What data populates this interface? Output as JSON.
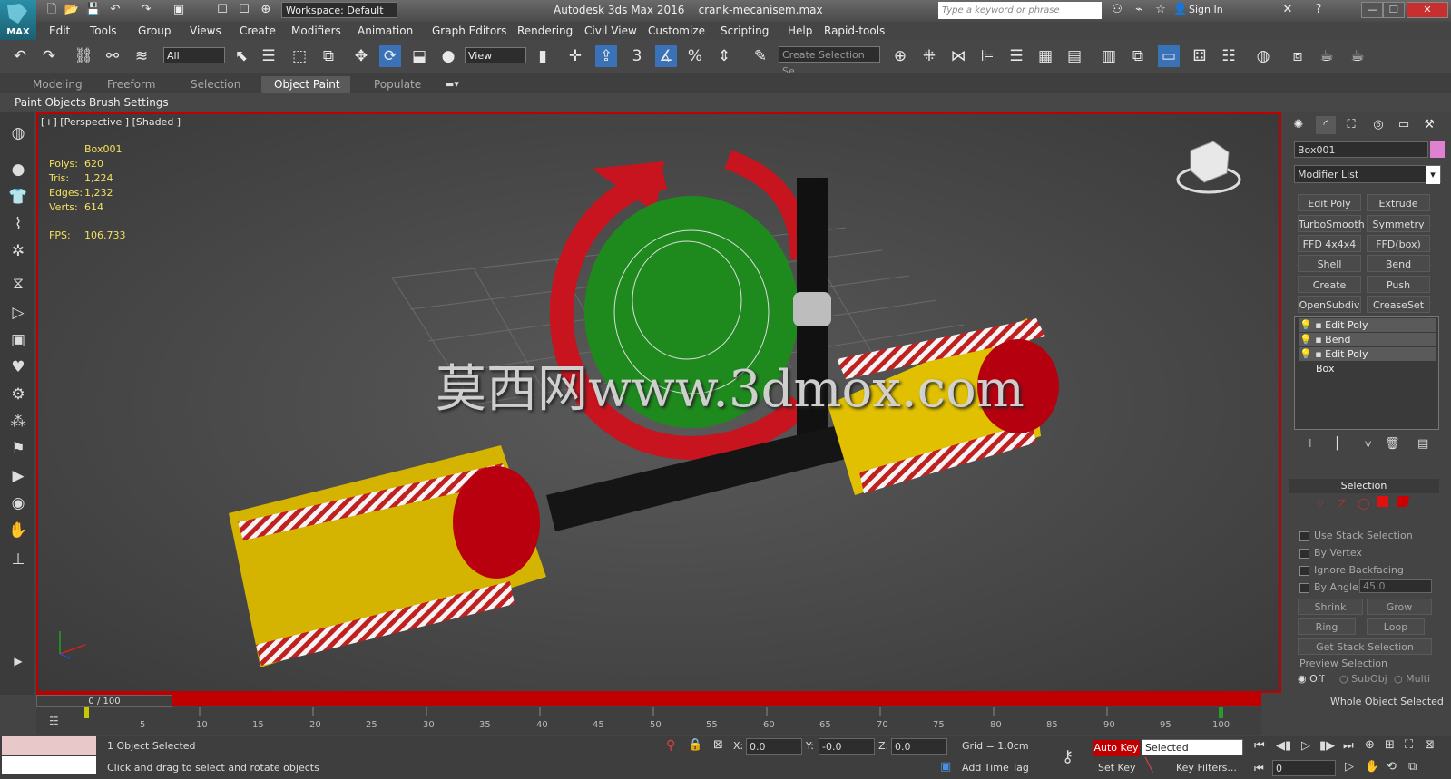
{
  "titlebar": {
    "app_title": "Autodesk 3ds Max 2016",
    "file_name": "crank-mecanisem.max",
    "logo_label": "MAX",
    "workspace": "Workspace: Default",
    "search_placeholder": "Type a keyword or phrase",
    "sign_in": "Sign In"
  },
  "menu": [
    "Edit",
    "Tools",
    "Group",
    "Views",
    "Create",
    "Modifiers",
    "Animation",
    "Graph Editors",
    "Rendering",
    "Civil View",
    "Customize",
    "Scripting",
    "Help",
    "Rapid-tools"
  ],
  "toolbar": {
    "filter": "All",
    "ref_coord": "View",
    "snap_label": "3",
    "selection_set": "Create Selection Se"
  },
  "ribbon": {
    "tabs": [
      "Modeling",
      "Freeform",
      "Selection",
      "Object Paint",
      "Populate"
    ],
    "active_tab": "Object Paint",
    "sub_items": [
      "Paint Objects",
      "Brush Settings"
    ]
  },
  "viewport": {
    "label": "[+] [Perspective ] [Shaded ]",
    "object": "Box001",
    "stats": [
      {
        "label": "Polys:",
        "value": "620"
      },
      {
        "label": "Tris:",
        "value": "1,224"
      },
      {
        "label": "Edges:",
        "value": "1,232"
      },
      {
        "label": "Verts:",
        "value": "614"
      }
    ],
    "fps_label": "FPS:",
    "fps_value": "106.733",
    "watermark": "莫西网www.3dmox.com"
  },
  "command_panel": {
    "object_name": "Box001",
    "object_color": "#e080d0",
    "modifier_list": "Modifier List",
    "modifier_buttons": [
      "Edit Poly",
      "Extrude",
      "TurboSmooth",
      "Symmetry",
      "FFD 4x4x4",
      "FFD(box)",
      "Shell",
      "Bend",
      "Create Holes",
      "Push",
      "OpenSubdiv",
      "CreaseSet"
    ],
    "stack": [
      "Edit Poly",
      "Bend",
      "Edit Poly",
      "Box"
    ],
    "selection": {
      "title": "Selection",
      "use_stack": "Use Stack Selection",
      "by_vertex": "By Vertex",
      "ignore_backfacing": "Ignore Backfacing",
      "by_angle": "By Angle:",
      "angle_value": "45.0",
      "shrink": "Shrink",
      "grow": "Grow",
      "ring": "Ring",
      "loop": "Loop",
      "get_stack": "Get Stack Selection",
      "preview_title": "Preview Selection",
      "preview_options": [
        "Off",
        "SubObj",
        "Multi"
      ],
      "status": "Whole Object Selected"
    }
  },
  "timeline": {
    "frame": "0 / 100",
    "ticks": [
      "5",
      "10",
      "15",
      "20",
      "25",
      "30",
      "35",
      "40",
      "45",
      "50",
      "55",
      "60",
      "65",
      "70",
      "75",
      "80",
      "85",
      "90",
      "95",
      "100"
    ]
  },
  "status": {
    "selected": "1 Object Selected",
    "prompt": "Click and drag to select and rotate objects",
    "x_label": "X:",
    "x": "0.0",
    "y_label": "Y:",
    "y": "-0.0",
    "z_label": "Z:",
    "z": "0.0",
    "grid": "Grid = 1.0cm",
    "add_time_tag": "Add Time Tag",
    "auto_key": "Auto Key",
    "key_mode": "Selected",
    "set_key": "Set Key",
    "key_filters": "Key Filters...",
    "current_frame": "0"
  }
}
